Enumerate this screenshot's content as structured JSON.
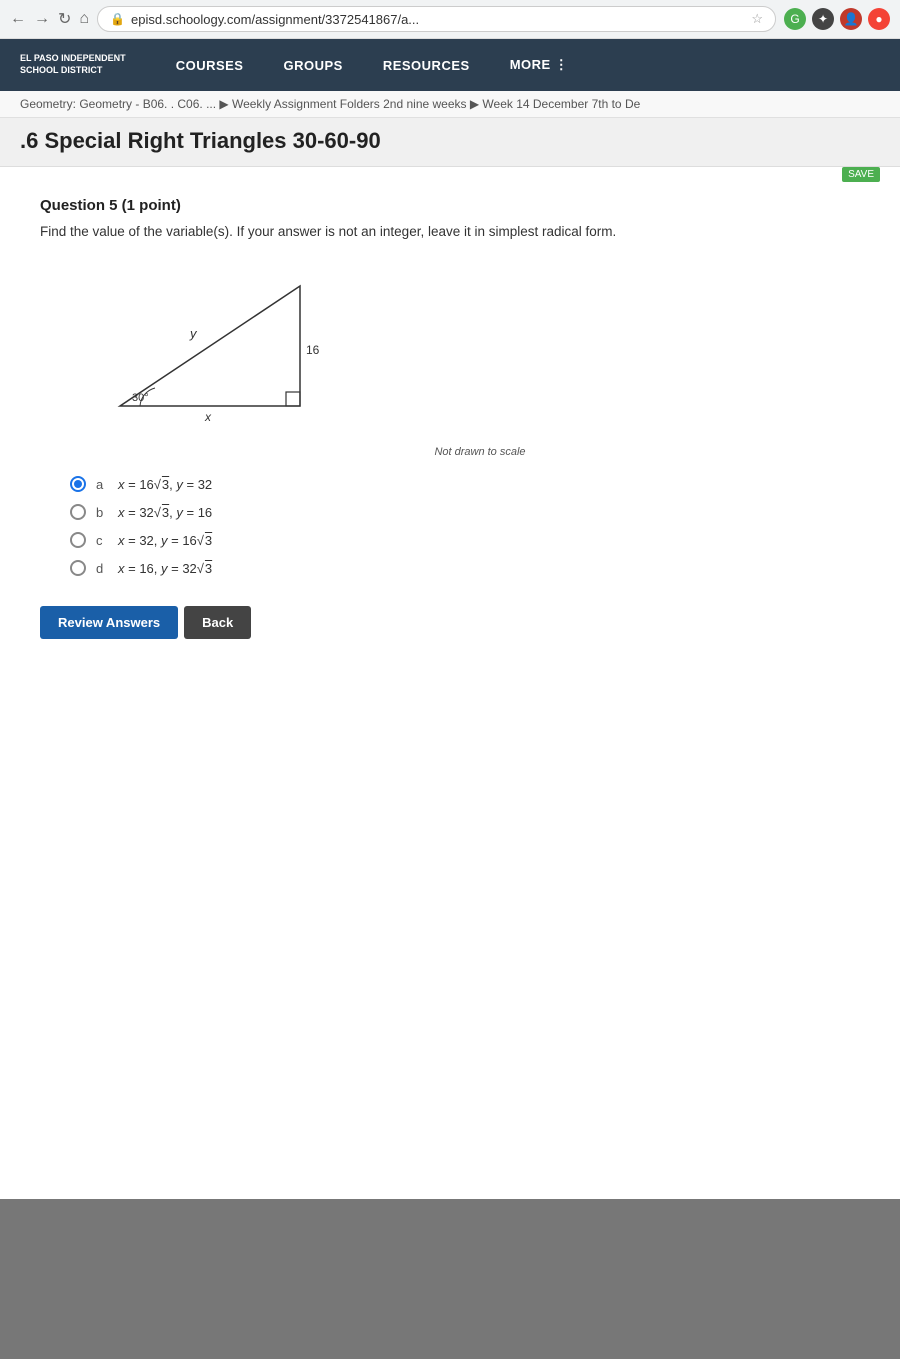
{
  "browser": {
    "url": "episd.schoology.com/assignment/3372541867/a...",
    "nav_back": "←",
    "nav_forward": "→",
    "nav_refresh": "↻",
    "nav_home": "⌂"
  },
  "nav": {
    "school_name_line1": "EL PASO INDEPENDENT",
    "school_name_line2": "SCHOOL DISTRICT",
    "links": [
      "COURSES",
      "GROUPS",
      "RESOURCES",
      "MORE ⋮"
    ]
  },
  "breadcrumb": {
    "text": "Geometry: Geometry - B06. . C06. ... ▶ Weekly Assignment Folders 2nd nine weeks ▶ Week 14 December 7th to De"
  },
  "page": {
    "title": ".6 Special Right Triangles 30-60-90"
  },
  "question": {
    "header": "Question 5 (1 point)",
    "instruction": "Find the value of the variable(s). If your answer is not an integer, leave it in simplest radical form.",
    "not_drawn": "Not drawn to scale",
    "choices": [
      {
        "letter": "a",
        "text": "x = 16√3, y = 32",
        "selected": true
      },
      {
        "letter": "b",
        "text": "x = 32√3, y = 16",
        "selected": false
      },
      {
        "letter": "c",
        "text": "x = 32, y = 16√3",
        "selected": false
      },
      {
        "letter": "d",
        "text": "x = 16, y = 32√3",
        "selected": false
      }
    ]
  },
  "buttons": {
    "review": "Review Answers",
    "back": "Back"
  },
  "diagram": {
    "angle": "30°",
    "side_label_right": "16",
    "var_x": "x",
    "var_y": "y"
  }
}
